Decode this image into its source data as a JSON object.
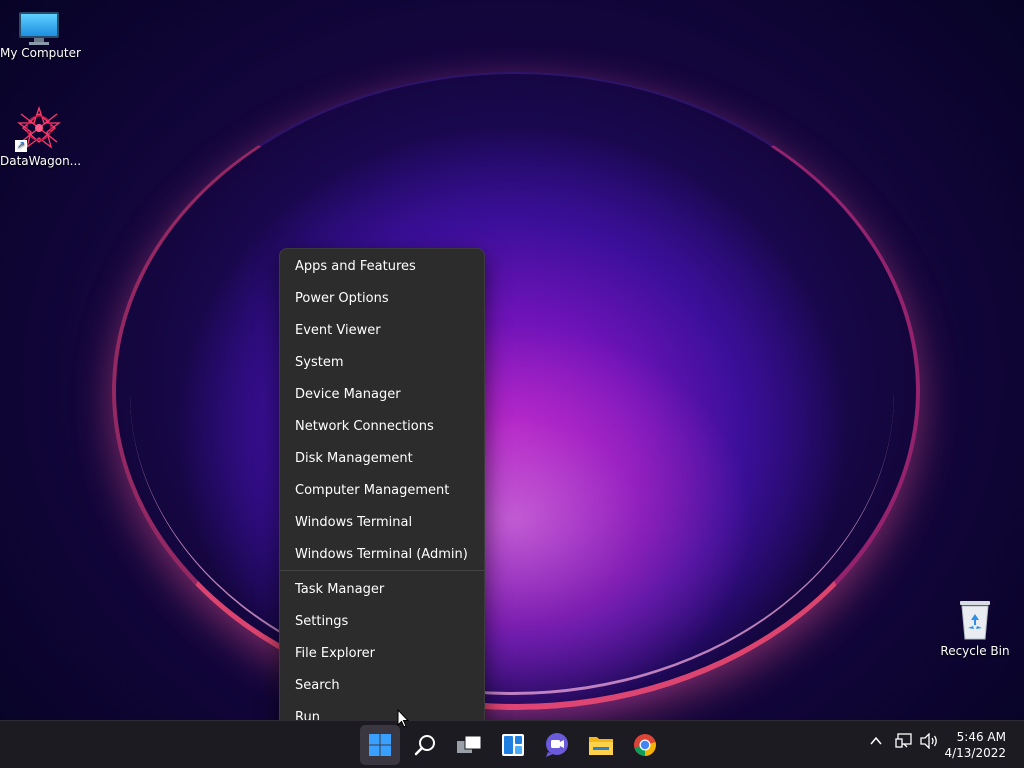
{
  "desktop": {
    "icons": [
      {
        "label": "My Computer",
        "icon": "monitor-icon"
      },
      {
        "label": "DataWagon...",
        "icon": "datawagon-logo-icon"
      },
      {
        "label": "Recycle Bin",
        "icon": "recycle-bin-icon"
      }
    ]
  },
  "context_menu": {
    "items": [
      {
        "label": "Apps and Features"
      },
      {
        "label": "Power Options"
      },
      {
        "label": "Event Viewer"
      },
      {
        "label": "System"
      },
      {
        "label": "Device Manager"
      },
      {
        "label": "Network Connections"
      },
      {
        "label": "Disk Management"
      },
      {
        "label": "Computer Management"
      },
      {
        "label": "Windows Terminal"
      },
      {
        "label": "Windows Terminal (Admin)"
      },
      {
        "label": "Task Manager"
      },
      {
        "label": "Settings"
      },
      {
        "label": "File Explorer"
      },
      {
        "label": "Search"
      },
      {
        "label": "Run"
      }
    ]
  },
  "taskbar": {
    "apps": [
      {
        "name": "start",
        "icon": "windows-start-icon",
        "active": true
      },
      {
        "name": "search",
        "icon": "search-icon"
      },
      {
        "name": "task-view",
        "icon": "task-view-icon"
      },
      {
        "name": "widgets",
        "icon": "widgets-icon"
      },
      {
        "name": "teams-chat",
        "icon": "teams-chat-icon"
      },
      {
        "name": "file-explorer",
        "icon": "folder-icon"
      },
      {
        "name": "chrome",
        "icon": "chrome-icon"
      }
    ],
    "tray": {
      "icons": [
        "chevron-up-icon",
        "network-icon",
        "volume-icon"
      ],
      "time": "5:46 AM",
      "date": "4/13/2022"
    }
  },
  "colors": {
    "menu_bg": "#2c2c2c",
    "taskbar_bg": "#1d1b22",
    "accent": "#3a9bff"
  }
}
